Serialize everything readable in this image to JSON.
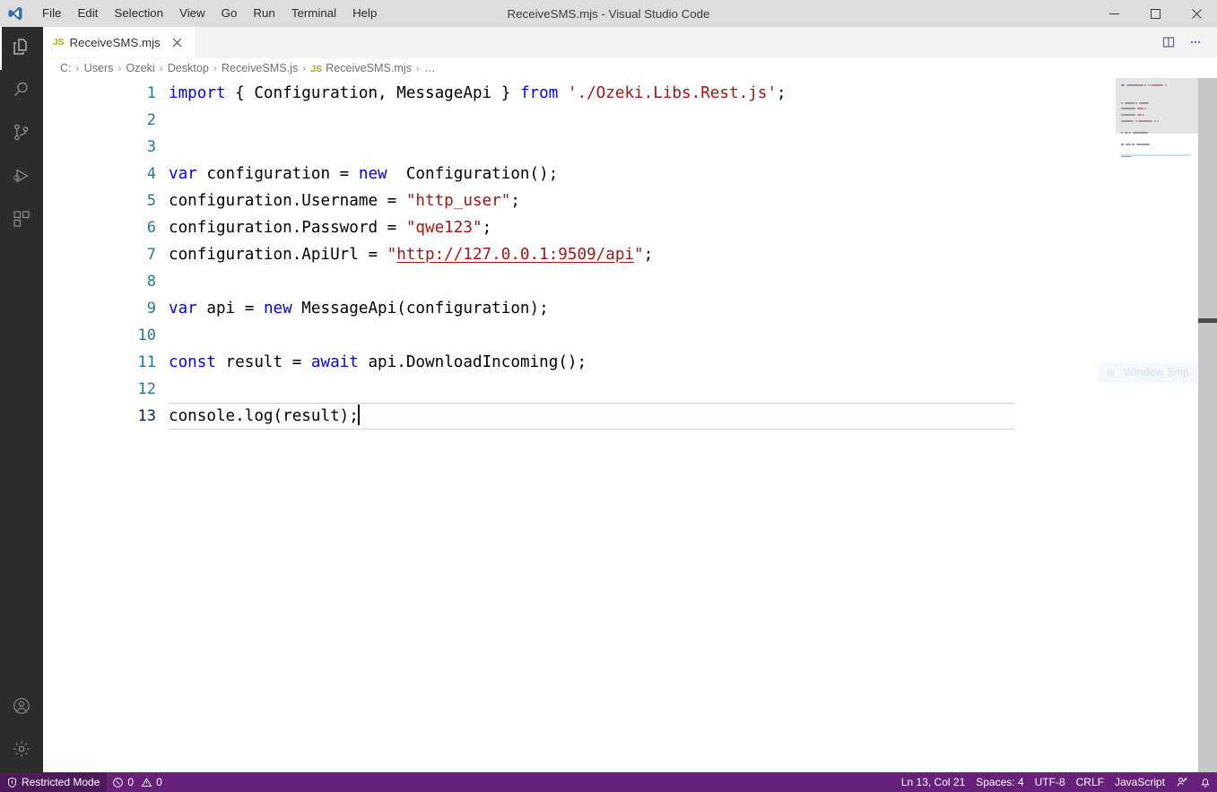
{
  "window": {
    "title": "ReceiveSMS.mjs - Visual Studio Code",
    "logo_icon": "vscode-logo-icon",
    "minimize_icon": "minimize-icon",
    "maximize_icon": "maximize-icon",
    "close_icon": "close-icon"
  },
  "menu": {
    "items": [
      {
        "label": "File"
      },
      {
        "label": "Edit"
      },
      {
        "label": "Selection"
      },
      {
        "label": "View"
      },
      {
        "label": "Go"
      },
      {
        "label": "Run"
      },
      {
        "label": "Terminal"
      },
      {
        "label": "Help"
      }
    ]
  },
  "activitybar": {
    "items": [
      {
        "name": "explorer",
        "icon": "files-icon",
        "active": true
      },
      {
        "name": "search",
        "icon": "search-icon",
        "active": false
      },
      {
        "name": "source-control",
        "icon": "source-control-icon",
        "active": false
      },
      {
        "name": "run-and-debug",
        "icon": "run-debug-icon",
        "active": false
      },
      {
        "name": "extensions",
        "icon": "extensions-icon",
        "active": false
      }
    ],
    "bottom": [
      {
        "name": "accounts",
        "icon": "account-icon"
      },
      {
        "name": "manage",
        "icon": "gear-icon"
      }
    ]
  },
  "tabs": {
    "open": [
      {
        "badge": "JS",
        "label": "ReceiveSMS.mjs",
        "active": true,
        "close_icon": "close-icon"
      }
    ],
    "actions": [
      {
        "name": "split-editor",
        "icon": "split-editor-icon"
      },
      {
        "name": "more-actions",
        "icon": "ellipsis-icon"
      }
    ]
  },
  "breadcrumb": {
    "separator": "›",
    "items": [
      {
        "label": "C:",
        "badge": ""
      },
      {
        "label": "Users",
        "badge": ""
      },
      {
        "label": "Ozeki",
        "badge": ""
      },
      {
        "label": "Desktop",
        "badge": ""
      },
      {
        "label": "ReceiveSMS.js",
        "badge": ""
      },
      {
        "label": "ReceiveSMS.mjs",
        "badge": "JS"
      },
      {
        "label": "…",
        "badge": ""
      }
    ]
  },
  "editor": {
    "language": "JavaScript",
    "lines": [
      {
        "no": "1",
        "tokens": [
          {
            "t": "import",
            "c": "k"
          },
          {
            "t": " { Configuration, MessageApi } ",
            "c": "p"
          },
          {
            "t": "from",
            "c": "k"
          },
          {
            "t": " ",
            "c": "p"
          },
          {
            "t": "'./Ozeki.Libs.Rest.js'",
            "c": "s"
          },
          {
            "t": ";",
            "c": "p"
          }
        ]
      },
      {
        "no": "2",
        "tokens": []
      },
      {
        "no": "3",
        "tokens": []
      },
      {
        "no": "4",
        "tokens": [
          {
            "t": "var",
            "c": "k"
          },
          {
            "t": " configuration = ",
            "c": "p"
          },
          {
            "t": "new",
            "c": "k"
          },
          {
            "t": "  Configuration();",
            "c": "p"
          }
        ]
      },
      {
        "no": "5",
        "tokens": [
          {
            "t": "configuration.Username = ",
            "c": "p"
          },
          {
            "t": "\"http_user\"",
            "c": "s"
          },
          {
            "t": ";",
            "c": "p"
          }
        ]
      },
      {
        "no": "6",
        "tokens": [
          {
            "t": "configuration.Password = ",
            "c": "p"
          },
          {
            "t": "\"qwe123\"",
            "c": "s"
          },
          {
            "t": ";",
            "c": "p"
          }
        ]
      },
      {
        "no": "7",
        "tokens": [
          {
            "t": "configuration.ApiUrl = ",
            "c": "p"
          },
          {
            "t": "\"",
            "c": "s"
          },
          {
            "t": "http://127.0.0.1:9509/api",
            "c": "lnk"
          },
          {
            "t": "\"",
            "c": "s"
          },
          {
            "t": ";",
            "c": "p"
          }
        ]
      },
      {
        "no": "8",
        "tokens": []
      },
      {
        "no": "9",
        "tokens": [
          {
            "t": "var",
            "c": "k"
          },
          {
            "t": " api = ",
            "c": "p"
          },
          {
            "t": "new",
            "c": "k"
          },
          {
            "t": " MessageApi(configuration);",
            "c": "p"
          }
        ]
      },
      {
        "no": "10",
        "tokens": []
      },
      {
        "no": "11",
        "tokens": [
          {
            "t": "const",
            "c": "k"
          },
          {
            "t": " result = ",
            "c": "p"
          },
          {
            "t": "await",
            "c": "k"
          },
          {
            "t": " api.DownloadIncoming();",
            "c": "p"
          }
        ]
      },
      {
        "no": "12",
        "tokens": []
      },
      {
        "no": "13",
        "current": true,
        "cursor": true,
        "tokens": [
          {
            "t": "console.log(result);",
            "c": "p"
          }
        ]
      }
    ]
  },
  "overlay": {
    "snip_label": "Window Snip"
  },
  "statusbar": {
    "restricted_mode": "Restricted Mode",
    "restricted_icon": "shield-icon",
    "errors_icon": "error-circle-icon",
    "errors": "0",
    "warnings_icon": "warning-triangle-icon",
    "warnings": "0",
    "cursor_position": "Ln 13, Col 21",
    "indentation": "Spaces: 4",
    "encoding": "UTF-8",
    "eol": "CRLF",
    "language": "JavaScript",
    "feedback_icon": "feedback-person-icon",
    "bell_icon": "bell-icon"
  },
  "colors": {
    "titlebar_bg": "#dddddd",
    "activitybar_bg": "#2c2c2c",
    "tabbar_bg": "#f3f3f3",
    "editor_bg": "#ffffff",
    "statusbar_bg": "#68217a",
    "restricted_bg": "#4d1a5c",
    "keyword": "#0000ff",
    "string": "#a31515",
    "linenumber": "#237893",
    "linenumber_active": "#0b216f",
    "js_badge": "#b8a613"
  }
}
